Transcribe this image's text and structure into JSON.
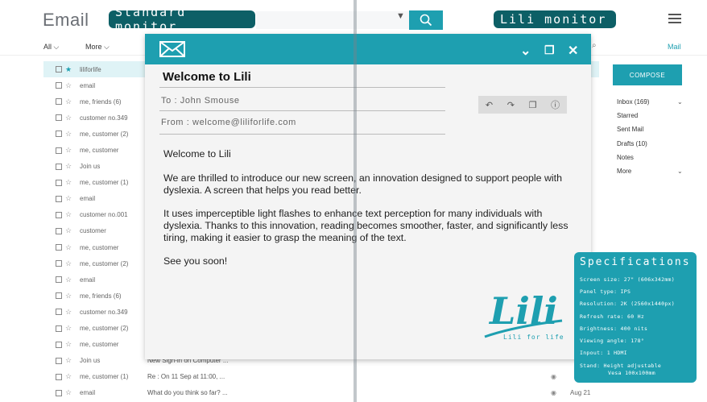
{
  "app_title": "Email",
  "labels": {
    "standard": "Standard monitor",
    "lili": "Lili monitor"
  },
  "toolbar": {
    "all": "All",
    "more": "More",
    "mail": "Mail"
  },
  "compose": "COMPOSE",
  "folders": [
    {
      "label": "Inbox (169)",
      "chevron": true
    },
    {
      "label": "Starred",
      "chevron": false
    },
    {
      "label": "Sent Mail",
      "chevron": false
    },
    {
      "label": "Drafts (10)",
      "chevron": false
    },
    {
      "label": "Notes",
      "chevron": false
    },
    {
      "label": "More",
      "chevron": true
    }
  ],
  "rows": [
    {
      "sender": "liliforlife",
      "subject": "",
      "date": "",
      "starred": true,
      "highlighted": true
    },
    {
      "sender": "email",
      "subject": "",
      "date": ""
    },
    {
      "sender": "me, friends (6)",
      "subject": "",
      "date": ""
    },
    {
      "sender": "customer no.349",
      "subject": "",
      "date": ""
    },
    {
      "sender": "me, customer (2)",
      "subject": "",
      "date": ""
    },
    {
      "sender": "me, customer",
      "subject": "",
      "date": ""
    },
    {
      "sender": "Join us",
      "subject": "",
      "date": ""
    },
    {
      "sender": "me, customer (1)",
      "subject": "",
      "date": ""
    },
    {
      "sender": "email",
      "subject": "",
      "date": ""
    },
    {
      "sender": "customer no.001",
      "subject": "",
      "date": ""
    },
    {
      "sender": "customer",
      "subject": "",
      "date": ""
    },
    {
      "sender": "me, customer",
      "subject": "",
      "date": ""
    },
    {
      "sender": "me, customer (2)",
      "subject": "",
      "date": ""
    },
    {
      "sender": "email",
      "subject": "",
      "date": ""
    },
    {
      "sender": "me, friends (6)",
      "subject": "",
      "date": ""
    },
    {
      "sender": "customer no.349",
      "subject": "",
      "date": ""
    },
    {
      "sender": "me, customer (2)",
      "subject": "",
      "date": ""
    },
    {
      "sender": "me, customer",
      "subject": "",
      "date": ""
    },
    {
      "sender": "Join us",
      "subject": "New Sign-in on Computer ...",
      "date": ""
    },
    {
      "sender": "me, customer (1)",
      "subject": "Re : On 11 Sep at 11:00, ...",
      "date": "",
      "eye": true
    },
    {
      "sender": "email",
      "subject": "What do you think so far? ...",
      "date": "Aug 21",
      "eye": true
    }
  ],
  "message": {
    "title": "Welcome to Lili",
    "to": "To : John Smouse",
    "from": "From : welcome@liliforlife.com",
    "paragraphs": [
      "Welcome to Lili",
      "We are thrilled to introduce our new screen, an innovation designed to support people with dyslexia. A screen that helps you read better.",
      "It uses imperceptible light flashes to enhance text perception for many individuals with dyslexia. Thanks to this innovation, reading becomes smoother, faster, and significantly less tiring, making it easier to grasp the meaning of the text.",
      "See you soon!"
    ]
  },
  "logo": {
    "text": "Lili",
    "tagline": "Lili for life"
  },
  "specs": {
    "title": "Specifications",
    "items": [
      "Screen size: 27\" (606x342mm)",
      "Panel type: IPS",
      "Resolution: 2K (2560x1440px)",
      "Refresh rate: 60 Hz",
      "Brightness: 400 nits",
      "Viewing angle: 178°",
      "Inpout: 1 HDMI",
      "Stand: Height adjustable",
      "Vesa 100x100mm"
    ]
  },
  "colors": {
    "accent": "#1e9fb0",
    "dark_label": "#0d5f66"
  }
}
